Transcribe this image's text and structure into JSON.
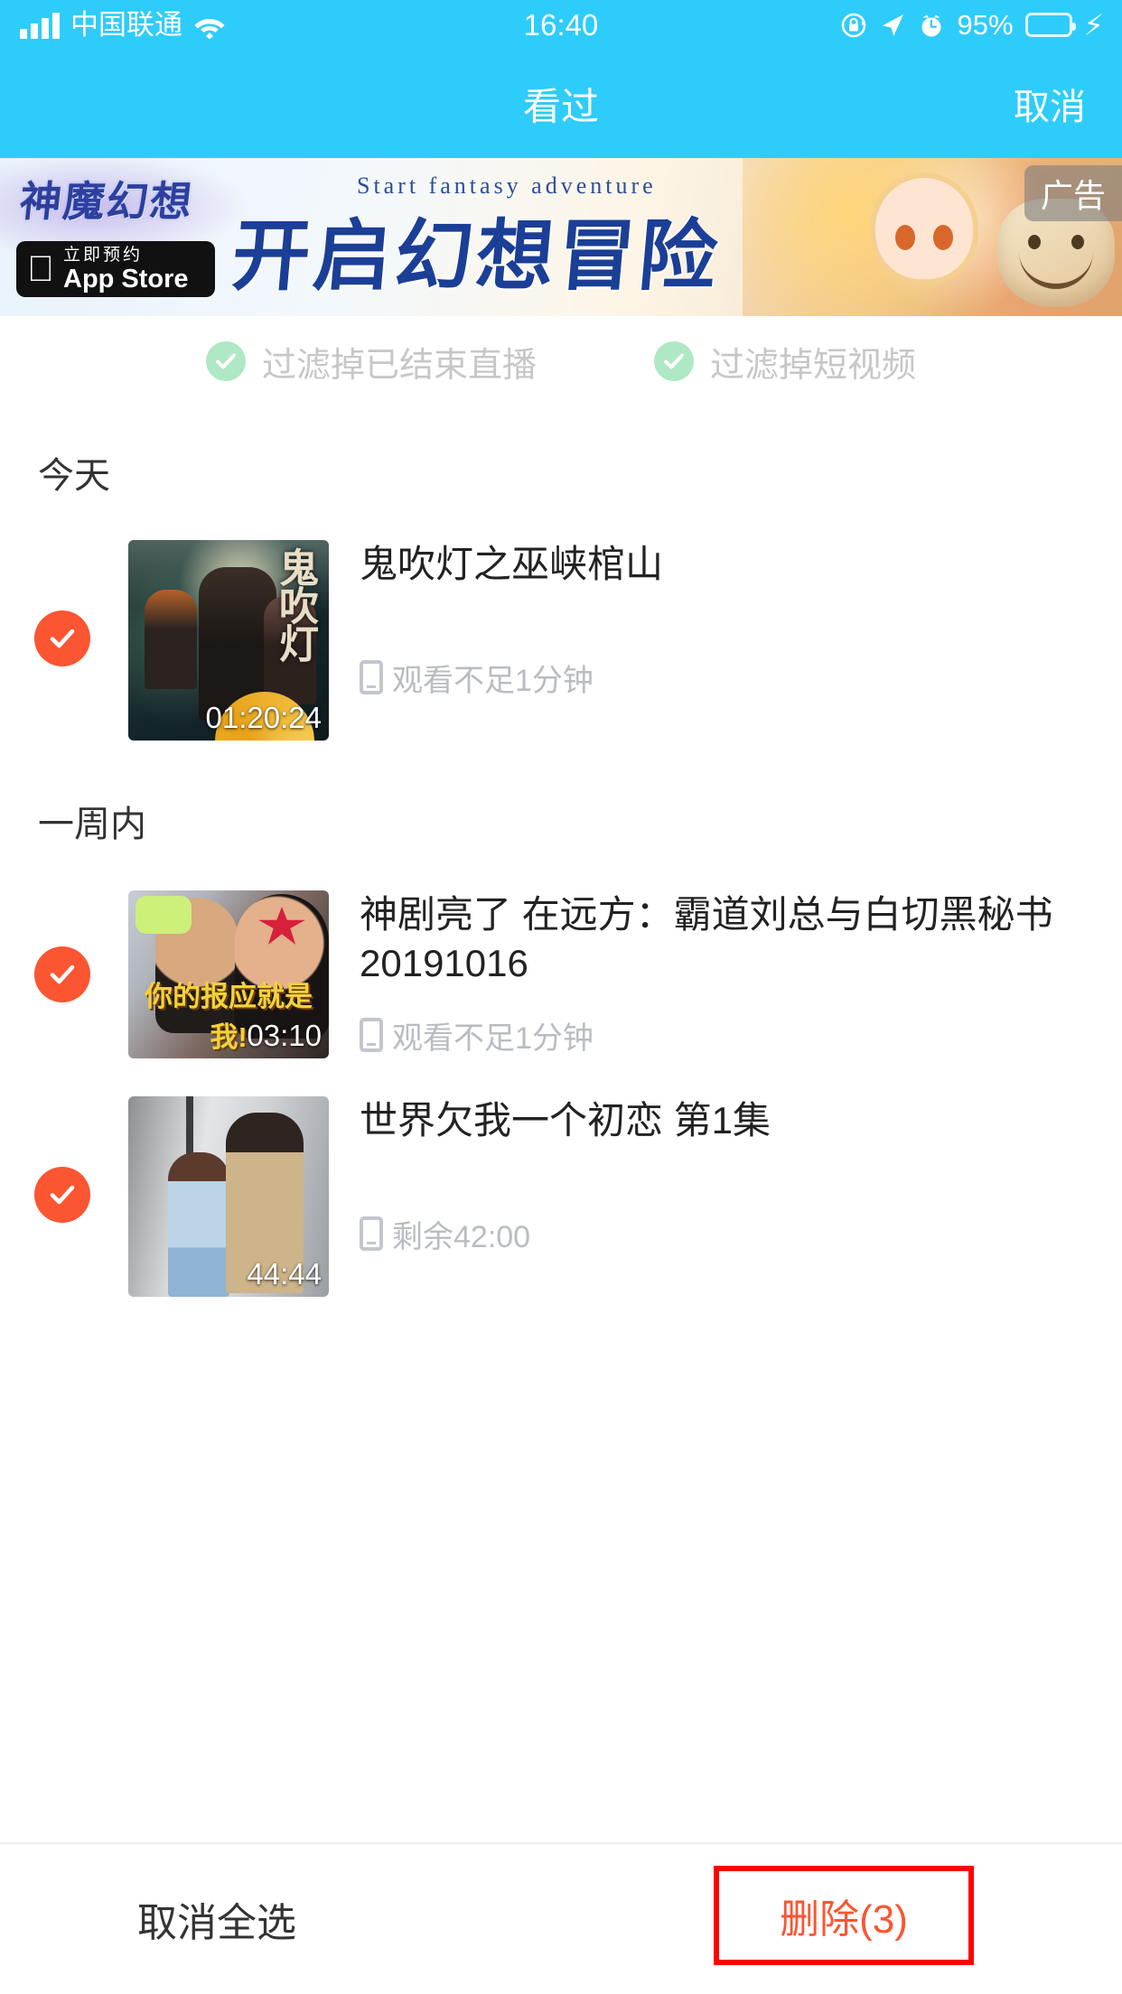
{
  "status_bar": {
    "carrier": "中国联通",
    "time": "16:40",
    "battery_percent": "95%",
    "icons": [
      "signal-bars-icon",
      "wifi-icon",
      "rotation-lock-icon",
      "location-arrow-icon",
      "alarm-clock-icon",
      "battery-icon",
      "charging-bolt-icon"
    ]
  },
  "nav": {
    "title": "看过",
    "cancel_label": "取消"
  },
  "banner": {
    "logo_text": "神魔幻想",
    "tagline_en": "Start fantasy adventure",
    "headline": "开启幻想冒险",
    "appstore_pre": "立即预约",
    "appstore_main": "App Store",
    "ad_badge": "广告"
  },
  "filters": [
    {
      "label": "过滤掉已结束直播",
      "checked": true
    },
    {
      "label": "过滤掉短视频",
      "checked": true
    }
  ],
  "sections": [
    {
      "title": "今天",
      "items": [
        {
          "title": "鬼吹灯之巫峡棺山",
          "duration": "01:20:24",
          "progress_text": "观看不足1分钟",
          "selected": true,
          "poster_title": "鬼吹灯"
        }
      ]
    },
    {
      "title": "一周内",
      "items": [
        {
          "title": "神剧亮了 在远方：霸道刘总与白切黑秘书 20191016",
          "duration": "03:10",
          "progress_text": "观看不足1分钟",
          "selected": true,
          "thumb_caption": "你的报应就是我!"
        },
        {
          "title": "世界欠我一个初恋 第1集",
          "duration": "44:44",
          "progress_text": "剩余42:00",
          "selected": true
        }
      ]
    }
  ],
  "bottom_bar": {
    "deselect_all_label": "取消全选",
    "delete_label": "删除(3)"
  },
  "colors": {
    "nav_blue": "#2ECCFA",
    "select_orange": "#FB5532",
    "delete_red": "#FF0000",
    "filter_green": "#AEE8C4"
  }
}
